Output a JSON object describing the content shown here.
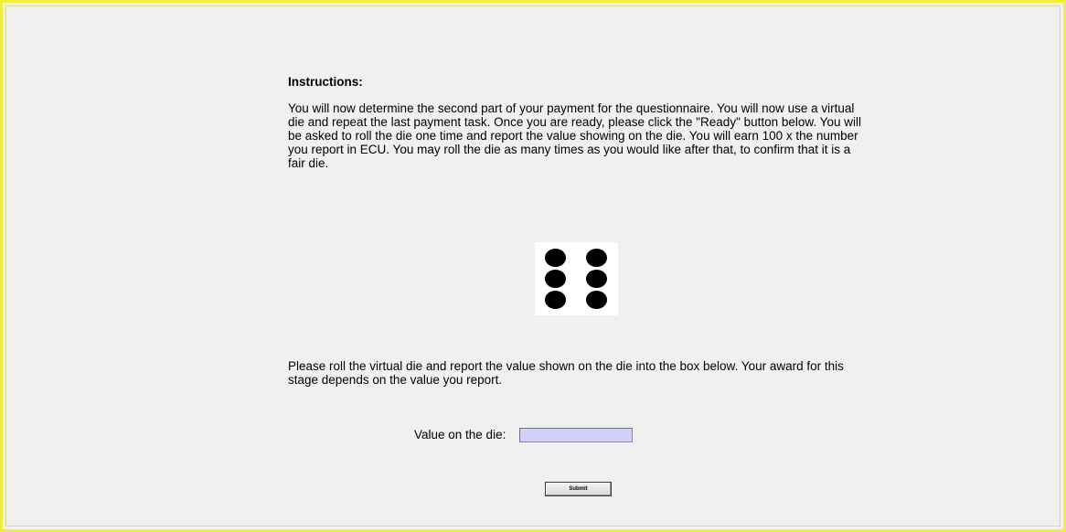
{
  "instructions": {
    "heading": "Instructions:",
    "paragraph": "You will now determine the second part of your payment for the questionnaire. You will now use a virtual die and repeat the last payment task.  Once you are ready, please click the \"Ready\" button below. You will be asked to roll the die one time and report the value showing on the die. You will earn 100 x the number you report in ECU. You may roll the die as many times as you would like after that, to confirm that it is a fair die."
  },
  "die": {
    "face_value": 6,
    "icon": "die-six-face-icon"
  },
  "report": {
    "paragraph": "Please roll the virtual die and report the value shown on the die into the box below. Your award for this stage depends on the value you report.",
    "field_label": "Value on the die:",
    "field_value": ""
  },
  "submit": {
    "label": "Submit"
  },
  "colors": {
    "frame_border": "#f2ef3c",
    "background": "#f0f0f0",
    "input_fill": "#d1d0fa"
  }
}
